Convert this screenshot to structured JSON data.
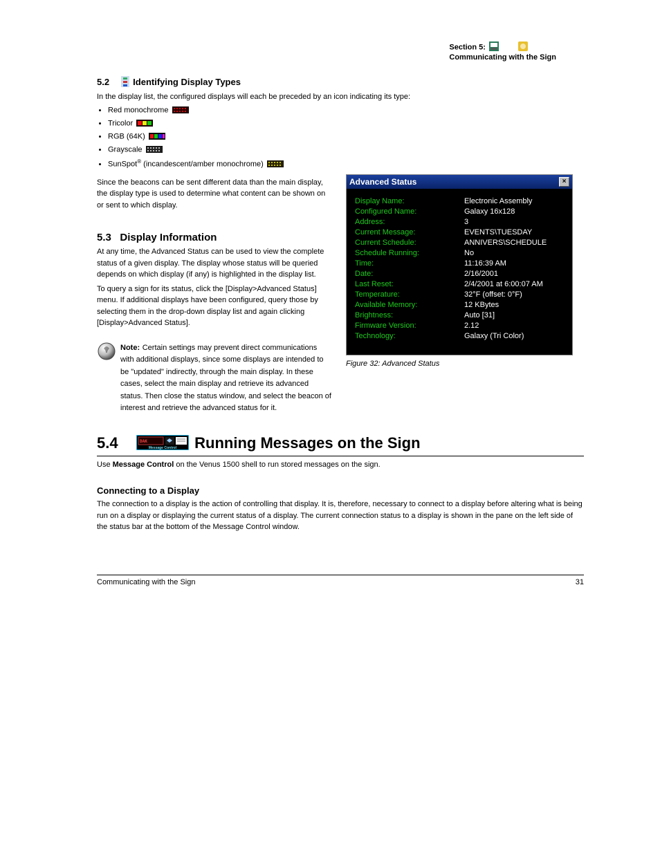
{
  "header": {
    "small_right_1": "Section 5:",
    "small_right_2": "Communicating with the Sign",
    "title_num": "5.2",
    "title_text": "Identifying Display Types",
    "intro": "In the display list, the configured displays will each be preceded by an icon indicating its type:"
  },
  "display_types": [
    {
      "label": "Red monochrome "
    },
    {
      "label": "Tricolor "
    },
    {
      "label": "RGB (64K) "
    },
    {
      "label": "Grayscale "
    },
    {
      "prefix": "SunSpot",
      "suffix": " (incandescent/amber monochrome) "
    }
  ],
  "para_after_list": "Since the beacons can be sent different data than the main display, the display type is used to determine what content can be shown on or sent to which display.",
  "section53": {
    "title_num": "5.3",
    "title_text": "Display Information",
    "p1": "At any time, the Advanced Status can be used to view the complete status of a given display. The display whose status will be queried depends on which display (if any) is highlighted in the display list.",
    "p2_1": "To query a sign for its status, click the [Display>Advanced Status] menu. If additional displays have been configured, query those by selecting them in the drop-down display list and again clicking [Display>Advanced Status].",
    "note_label": "Note:",
    "note_text": "Certain settings may prevent direct communications with additional displays, since some displays are intended to be \"updated\" indirectly, through the main display. In these cases, select the main display and retrieve its advanced status. Then close the status window, and select the beacon of interest and retrieve the advanced status for it."
  },
  "status": {
    "title": "Advanced Status",
    "rows": [
      {
        "label": "Display Name:",
        "value": "Electronic Assembly"
      },
      {
        "label": "Configured Name:",
        "value": "Galaxy 16x128"
      },
      {
        "label": "Address:",
        "value": "3"
      },
      {
        "label": "Current Message:",
        "value": "EVENTS\\TUESDAY"
      },
      {
        "label": "Current Schedule:",
        "value": "ANNIVERS\\SCHEDULE"
      },
      {
        "label": "Schedule Running:",
        "value": "No"
      },
      {
        "label": "Time:",
        "value": "11:16:39 AM"
      },
      {
        "label": "Date:",
        "value": "2/16/2001"
      },
      {
        "label": "Last Reset:",
        "value": "2/4/2001 at 6:00:07 AM"
      },
      {
        "label": "Temperature:",
        "value": "32°F (offset: 0°F)"
      },
      {
        "label": "Available Memory:",
        "value": "12 KBytes"
      },
      {
        "label": "Brightness:",
        "value": "Auto [31]"
      },
      {
        "label": "Firmware Version:",
        "value": "2.12"
      },
      {
        "label": "Technology:",
        "value": "Galaxy (Tri Color)"
      }
    ]
  },
  "section54": {
    "title_num": "5.4",
    "title_text": "Running Messages on the Sign",
    "p_intro_prefix": "Use ",
    "p_intro_bold": "Message Control",
    "p_intro_suffix": " on the Venus 1500 shell to run stored messages on the sign.",
    "sub_title": "Connecting to a Display",
    "p_sub": "The connection to a display is the action of controlling that display. It is, therefore, necessary to connect to a display before altering what is being run on a display or displaying the current status of a display. The current connection status to a display is shown in the pane on the left side of the status bar at the bottom of the Message Control window."
  },
  "footer": {
    "left": "Communicating with the Sign",
    "right": "31"
  },
  "figure_caption": "Figure 32: Advanced Status"
}
